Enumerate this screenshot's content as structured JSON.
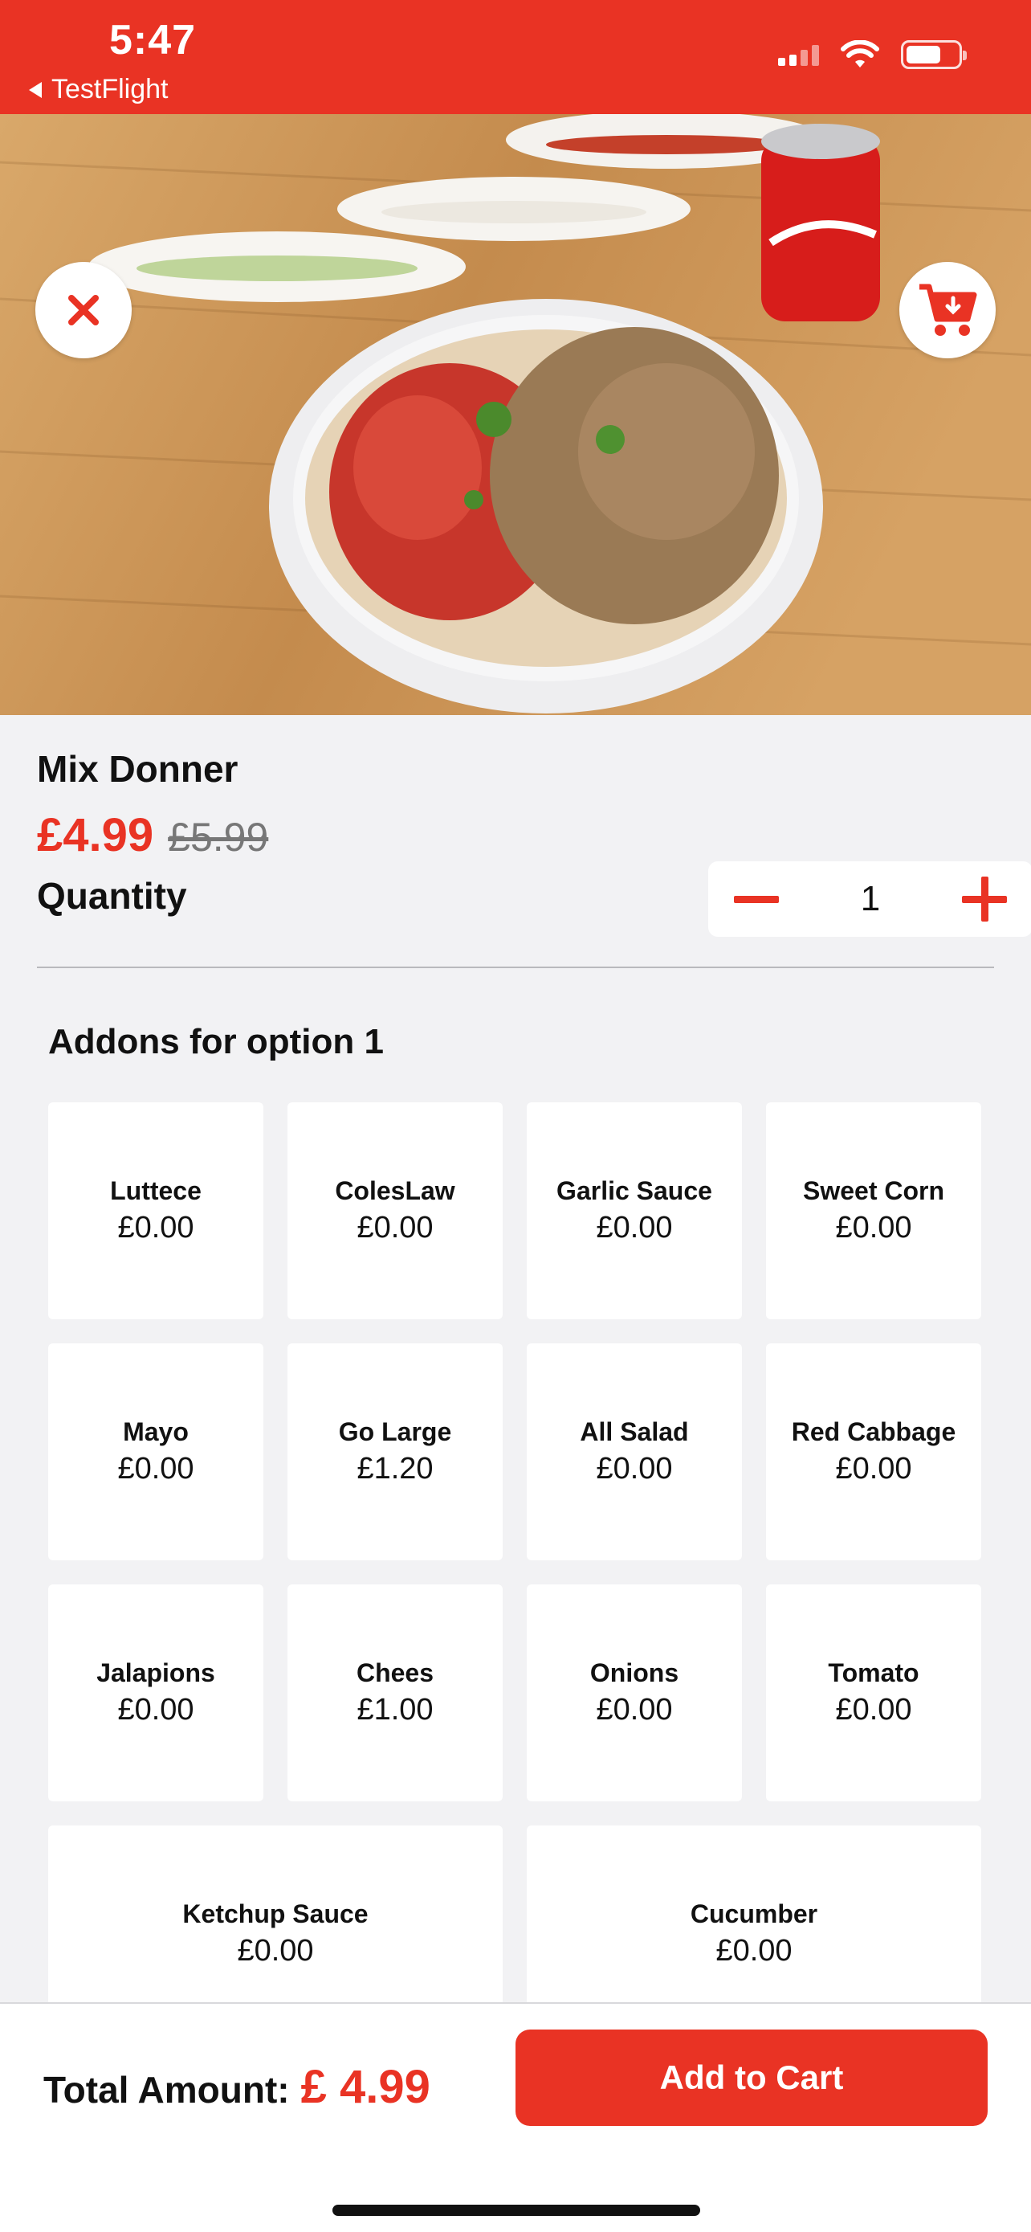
{
  "status_bar": {
    "time": "5:47",
    "back_app": "TestFlight"
  },
  "hero": {
    "image_subject": "mix-donner-plate-photo",
    "close_icon": "close-icon",
    "cart_icon": "cart-download-icon"
  },
  "product": {
    "name": "Mix Donner",
    "price": "£4.99",
    "old_price": "£5.99",
    "quantity_label": "Quantity",
    "quantity": "1"
  },
  "addons": {
    "title": "Addons for option 1",
    "items": [
      {
        "name": "Luttece",
        "price": "£0.00"
      },
      {
        "name": "ColesLaw",
        "price": "£0.00"
      },
      {
        "name": "Garlic Sauce",
        "price": "£0.00"
      },
      {
        "name": "Sweet Corn",
        "price": "£0.00"
      },
      {
        "name": "Mayo",
        "price": "£0.00"
      },
      {
        "name": "Go Large",
        "price": "£1.20"
      },
      {
        "name": "All Salad",
        "price": "£0.00"
      },
      {
        "name": "Red Cabbage",
        "price": "£0.00"
      },
      {
        "name": "Jalapions",
        "price": "£0.00"
      },
      {
        "name": "Chees",
        "price": "£1.00"
      },
      {
        "name": "Onions",
        "price": "£0.00"
      },
      {
        "name": "Tomato",
        "price": "£0.00"
      },
      {
        "name": "Ketchup Sauce",
        "price": "£0.00"
      },
      {
        "name": "Cucumber",
        "price": "£0.00"
      }
    ]
  },
  "footer": {
    "total_label": "Total Amount:",
    "total_value": "£ 4.99",
    "add_to_cart": "Add to Cart"
  },
  "colors": {
    "accent": "#e93324",
    "background": "#f2f2f4"
  }
}
